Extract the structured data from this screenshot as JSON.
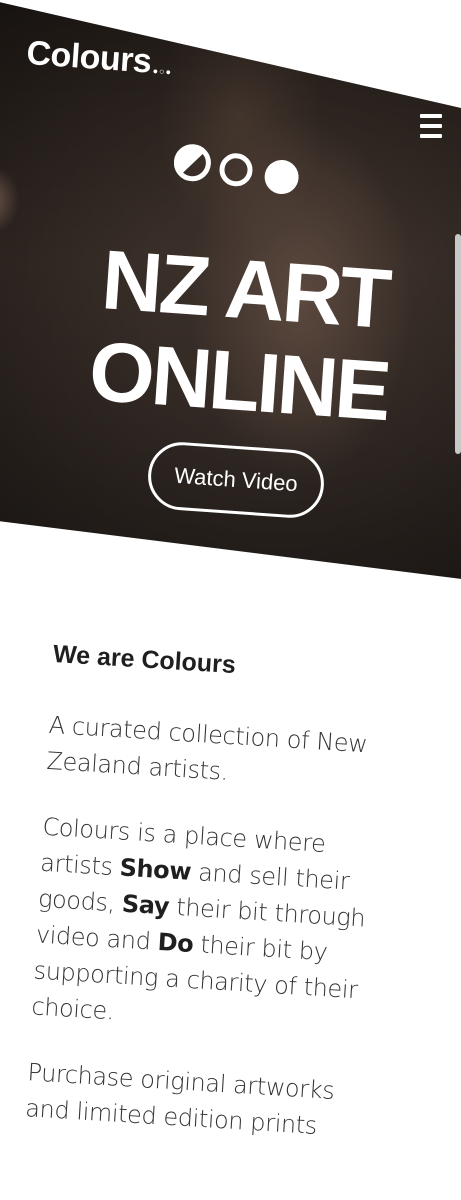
{
  "header": {
    "logo_text": "Colours",
    "logo_dots": "●○●",
    "menu_icon": "hamburger-icon"
  },
  "hero": {
    "headline_line1": "NZ ART",
    "headline_line2": "ONLINE",
    "watch_video_label": "Watch Video",
    "brand_icon": "three-circles-icon"
  },
  "content": {
    "heading": "We are Colours",
    "tagline": "A curated collection of New Zealand artists.",
    "description": {
      "part1": "Colours is a place where artists ",
      "show": "Show",
      "part2": " and sell their goods, ",
      "say": "Say",
      "part3": " their bit through video and ",
      "do": "Do",
      "part4": " their bit by supporting a charity of their choice."
    },
    "purchase_text": "Purchase original artworks and limited edition prints"
  },
  "colors": {
    "hero_bg": "#2e2622",
    "text_dark": "#2a2a2a",
    "white": "#ffffff"
  }
}
